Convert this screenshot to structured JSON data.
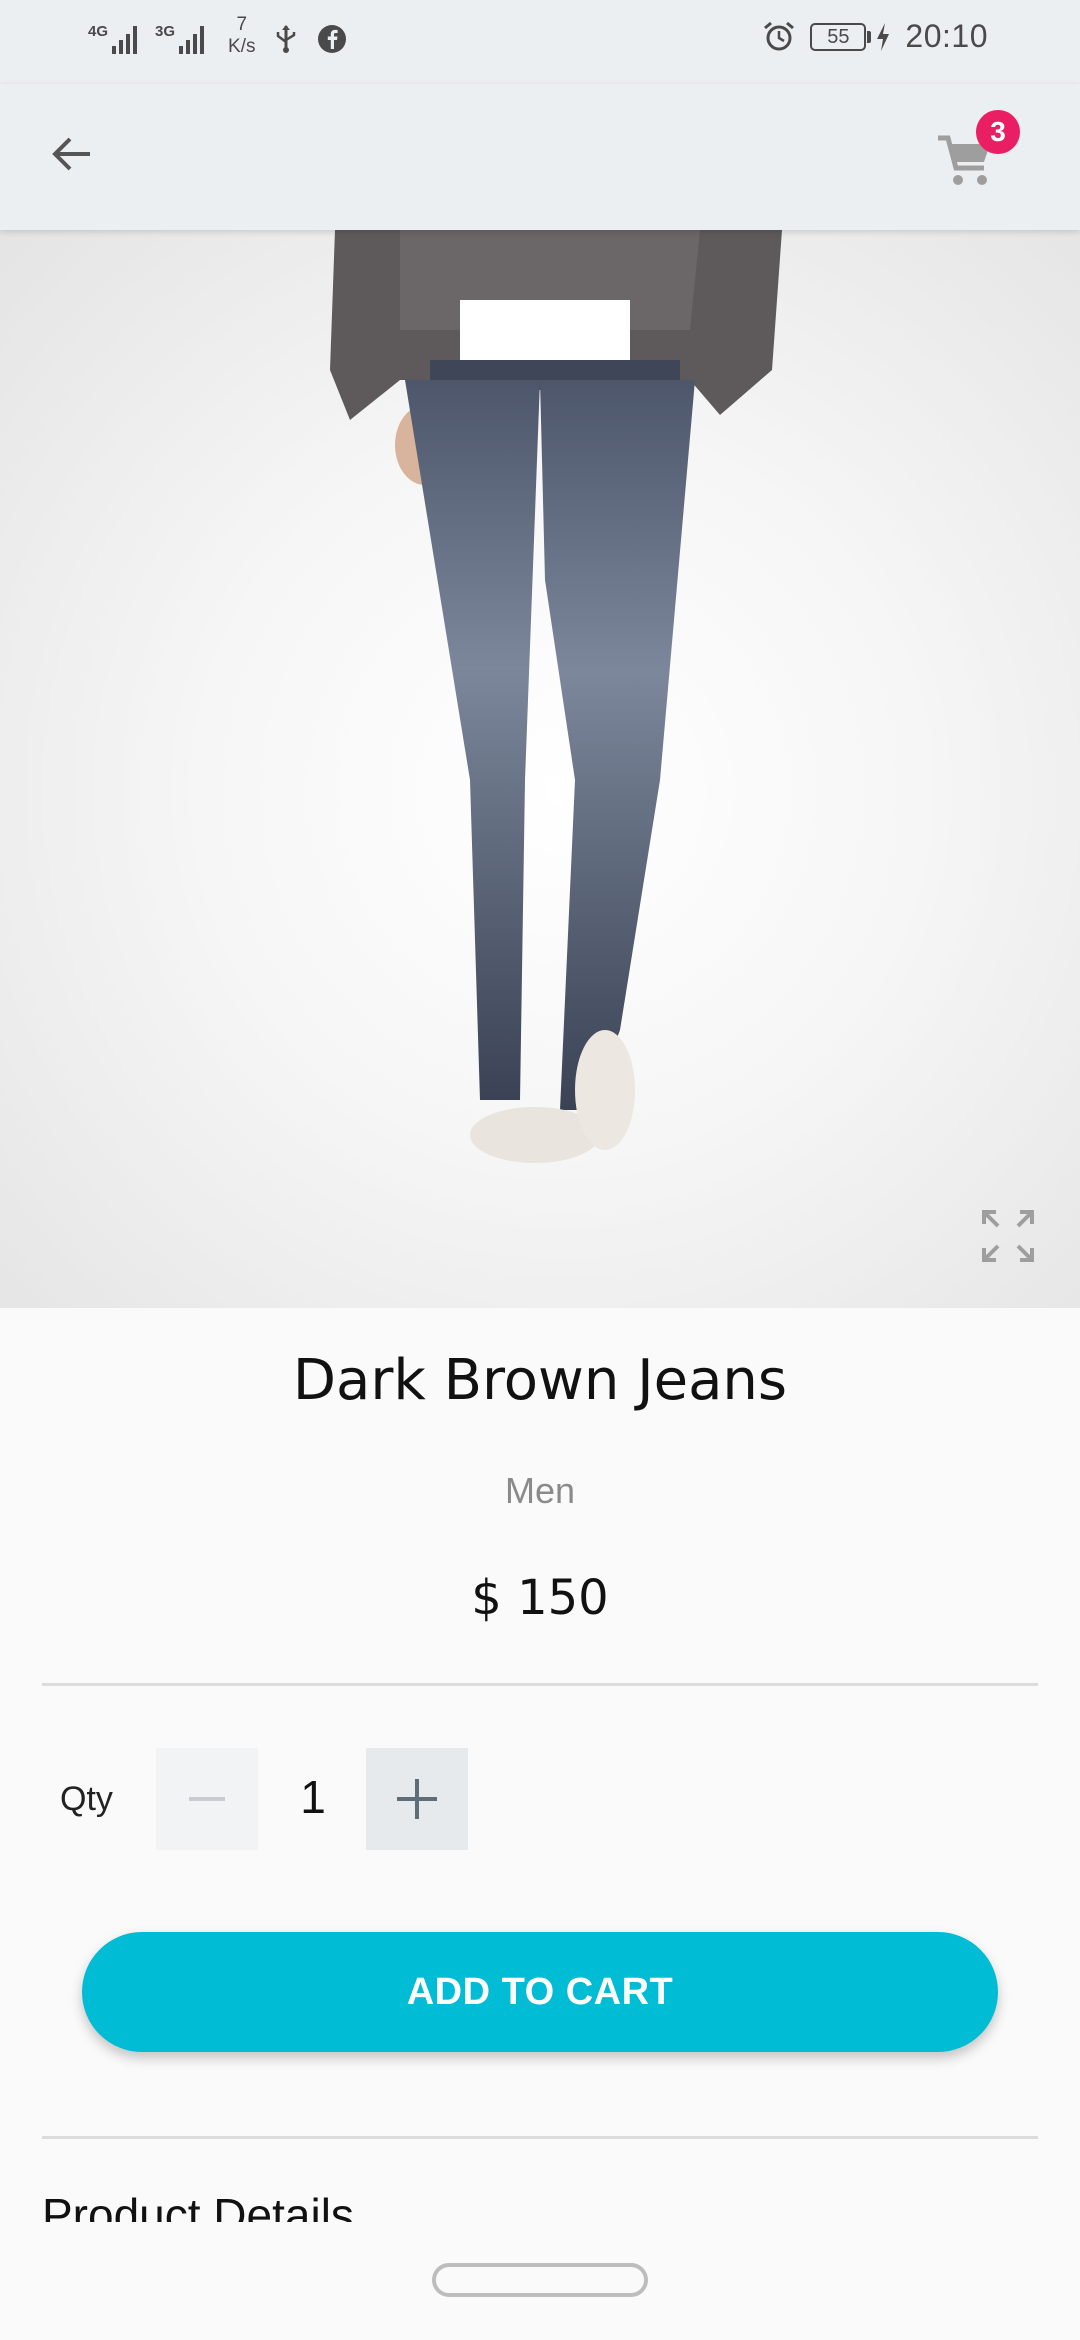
{
  "status_bar": {
    "signal1_label": "4G",
    "signal2_label": "3G",
    "speed_value": "7",
    "speed_unit": "K/s",
    "battery_level": "55",
    "time": "20:10"
  },
  "header": {
    "cart_count": "3"
  },
  "product": {
    "name": "Dark Brown Jeans",
    "category": "Men",
    "price": "$ 150"
  },
  "quantity": {
    "label": "Qty",
    "value": "1"
  },
  "actions": {
    "add_to_cart_label": "ADD TO CART"
  },
  "sections": {
    "details_title": "Product Details"
  },
  "icons": {
    "back": "arrow-left-icon",
    "cart": "shopping-cart-icon",
    "expand": "fullscreen-icon",
    "minus": "minus-icon",
    "plus": "plus-icon"
  },
  "colors": {
    "accent": "#00bcd4",
    "badge": "#e91e63",
    "app_bar": "#eceff2"
  }
}
